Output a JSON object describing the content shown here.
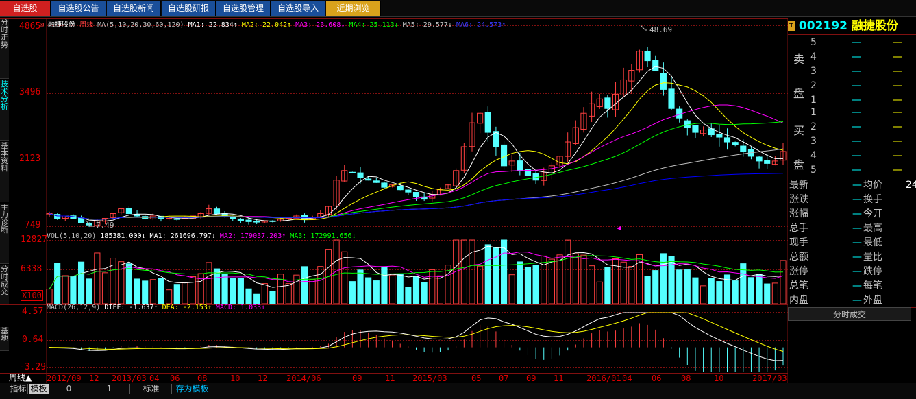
{
  "tabs": [
    {
      "label": "自选股"
    },
    {
      "label": "自选股公告"
    },
    {
      "label": "自选股新闻"
    },
    {
      "label": "自选股研报"
    },
    {
      "label": "自选股管理"
    },
    {
      "label": "自选股导入"
    },
    {
      "label": "近期浏览"
    }
  ],
  "side_tabs": [
    "分时走势",
    "技术分析",
    "基本资料",
    "主力诊断",
    "分时成交",
    "基地"
  ],
  "stock": {
    "code": "002192",
    "name": "融捷股份",
    "period": "周线"
  },
  "price_axis": {
    "labels": [
      "4865",
      "3496",
      "2123",
      "749"
    ],
    "max_label": "48.69",
    "min_label": "7.49"
  },
  "ma_legend": {
    "title": "融捷股份",
    "period": "周线",
    "params": "MA(5,10,20,30,60,120)",
    "items": [
      {
        "text": "MA1: 22.834↑",
        "color": "#ffffff"
      },
      {
        "text": "MA2: 22.042↑",
        "color": "#ffff00"
      },
      {
        "text": "MA3: 23.608↓",
        "color": "#ff00ff"
      },
      {
        "text": "MA4: 25.113↓",
        "color": "#00ff00"
      },
      {
        "text": "MA5: 29.577↓",
        "color": "#c0c0c0"
      },
      {
        "text": "MA6: 24.573↑",
        "color": "#0000ff"
      }
    ]
  },
  "vol_axis": {
    "labels": [
      "12827",
      "6338",
      "X100"
    ]
  },
  "vol_legend": {
    "params": "VOL(5,10,20)",
    "vol": "185381.000↓",
    "items": [
      {
        "text": "MA1: 261696.797↓",
        "color": "#ffffff"
      },
      {
        "text": "MA2: 179037.203↑",
        "color": "#ff00ff"
      },
      {
        "text": "MA3: 172991.656↓",
        "color": "#00ff00"
      }
    ]
  },
  "macd_axis": {
    "labels": [
      "4.57",
      "0.64",
      "-3.29"
    ]
  },
  "macd_legend": {
    "params": "MACD(26,12,9)",
    "items": [
      {
        "text": "DIFF: -1.637↑",
        "color": "#ffffff"
      },
      {
        "text": "DEA: -2.153↑",
        "color": "#ffff00"
      },
      {
        "text": "MACD: 1.033↑",
        "color": "#ff00ff"
      }
    ]
  },
  "time_axis": [
    "2012/09",
    "12",
    "2013/03",
    "04",
    "06",
    "08",
    "10",
    "12",
    "2014/06",
    "09",
    "11",
    "2015/03",
    "05",
    "07",
    "09",
    "11",
    "2016/01",
    "04",
    "06",
    "08",
    "10",
    "2017/03"
  ],
  "order_book": {
    "sell_label": "卖盘",
    "buy_label": "买盘",
    "sell": [
      {
        "level": "5",
        "price": "—",
        "vol": "—"
      },
      {
        "level": "4",
        "price": "—",
        "vol": "—"
      },
      {
        "level": "3",
        "price": "—",
        "vol": "—"
      },
      {
        "level": "2",
        "price": "—",
        "vol": "—"
      },
      {
        "level": "1",
        "price": "—",
        "vol": "—"
      }
    ],
    "buy": [
      {
        "level": "1",
        "price": "—",
        "vol": "—"
      },
      {
        "level": "2",
        "price": "—",
        "vol": "—"
      },
      {
        "level": "3",
        "price": "—",
        "vol": "—"
      },
      {
        "level": "4",
        "price": "—",
        "vol": "—"
      },
      {
        "level": "5",
        "price": "—",
        "vol": "—"
      }
    ]
  },
  "quote": [
    {
      "l1": "最新",
      "v1": "—",
      "l2": "均价",
      "v2": "24"
    },
    {
      "l1": "涨跌",
      "v1": "—",
      "l2": "换手",
      "v2": ""
    },
    {
      "l1": "涨幅",
      "v1": "—",
      "l2": "今开",
      "v2": ""
    },
    {
      "l1": "总手",
      "v1": "—",
      "l2": "最高",
      "v2": ""
    },
    {
      "l1": "现手",
      "v1": "—",
      "l2": "最低",
      "v2": ""
    },
    {
      "l1": "总额",
      "v1": "—",
      "l2": "量比",
      "v2": ""
    },
    {
      "l1": "涨停",
      "v1": "—",
      "l2": "跌停",
      "v2": ""
    },
    {
      "l1": "总笔",
      "v1": "—",
      "l2": "每笔",
      "v2": ""
    },
    {
      "l1": "内盘",
      "v1": "—",
      "l2": "外盘",
      "v2": ""
    }
  ],
  "panel_tab": "分时成交",
  "bottom": {
    "period": "周线▲",
    "tabs": [
      "指标",
      "模板",
      "0",
      "1",
      "标准",
      "存为模板"
    ]
  },
  "colors": {
    "up": "#ff4040",
    "down": "#54ffff",
    "grid": "#801010"
  },
  "chart_data": {
    "type": "candlestick",
    "title": "融捷股份 周线",
    "x_range": [
      "2012/09",
      "2017/03"
    ],
    "ylim": [
      7.49,
      48.69
    ],
    "weekly_close_approx": [
      10,
      9,
      9.5,
      9,
      8,
      7.6,
      8.5,
      9,
      10,
      11,
      10,
      9.5,
      9,
      9.5,
      9,
      9,
      8.8,
      9,
      9.5,
      10,
      11,
      10,
      9.5,
      9,
      8.5,
      8.3,
      8.2,
      8.5,
      8.4,
      8.8,
      9,
      9.5,
      8.7,
      9.2,
      10,
      11.5,
      17,
      19,
      18.5,
      17.5,
      17,
      16.5,
      15.5,
      16,
      15,
      14.5,
      13.5,
      13,
      14,
      15,
      16,
      19,
      24,
      29,
      31,
      27,
      24,
      20,
      21,
      19,
      18,
      17,
      18.5,
      20,
      22,
      25,
      28,
      31,
      33,
      34,
      32,
      35,
      38,
      40,
      44,
      42,
      40,
      36,
      32,
      30,
      28,
      27,
      27.5,
      26.5,
      26,
      25,
      24.5,
      23,
      22,
      21,
      20.5,
      21,
      23
    ]
  }
}
